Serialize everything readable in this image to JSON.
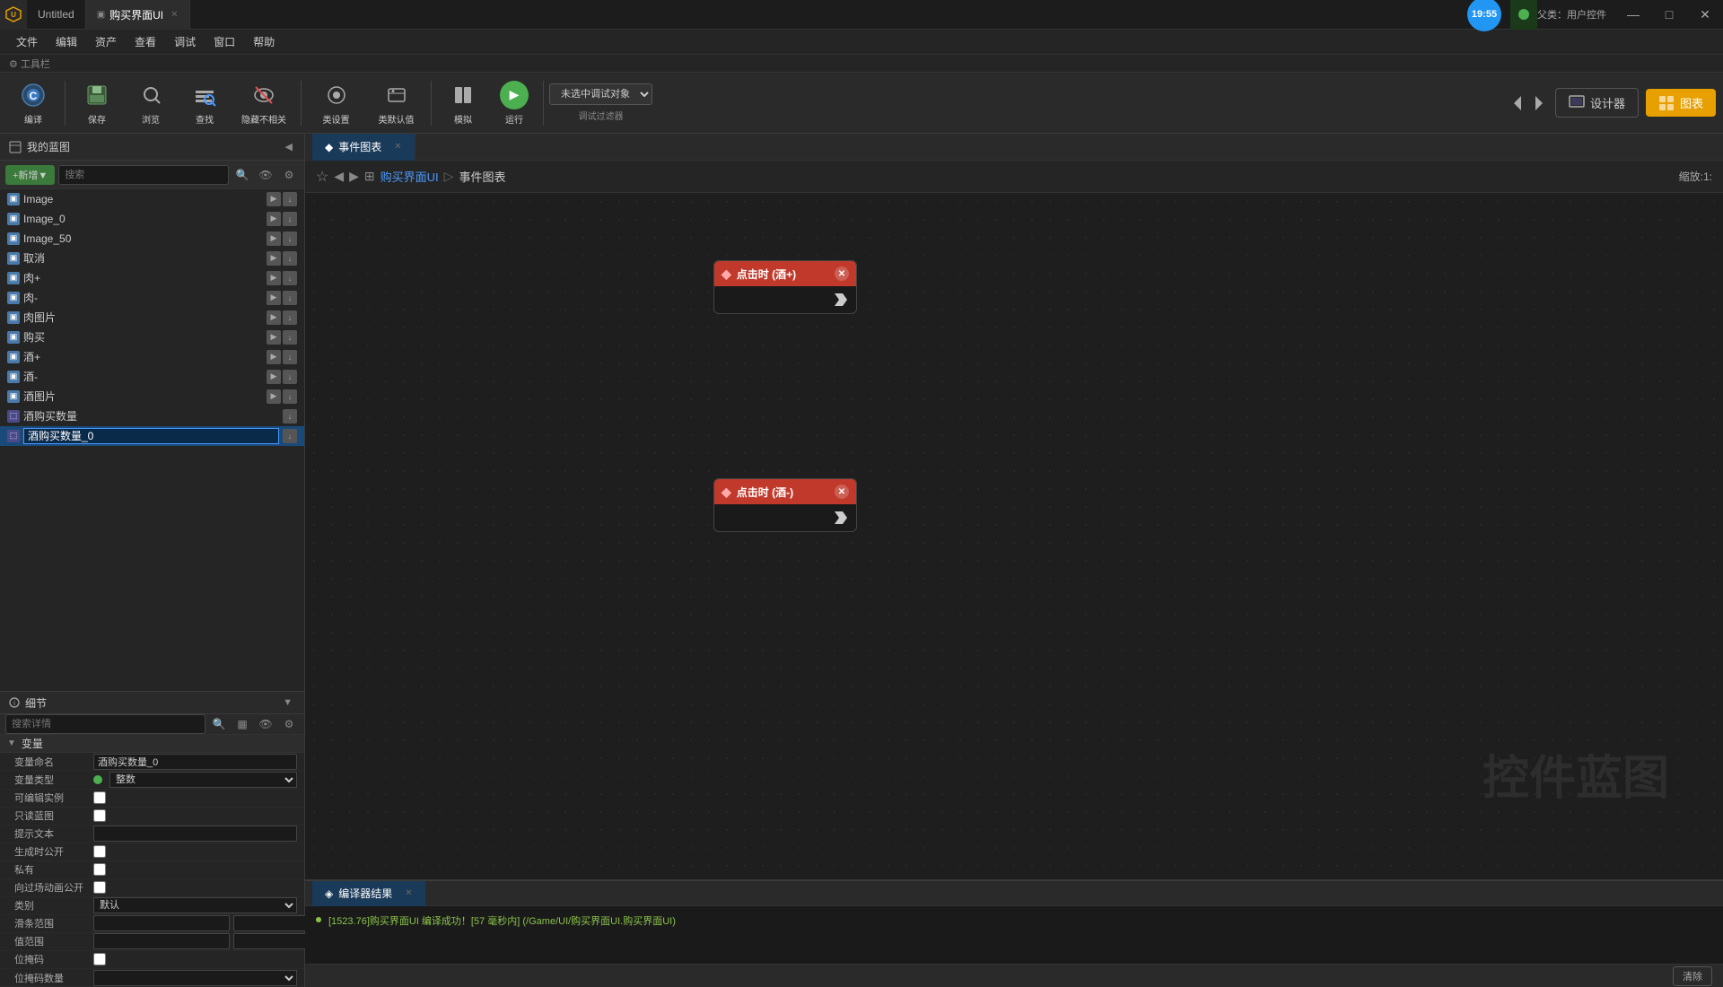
{
  "titlebar": {
    "app_icon": "U",
    "tab1_label": "Untitled",
    "tab2_label": "购买界面UI",
    "tab2_icon": "▣",
    "clock": "19:55",
    "user_label": "父类：用户控件",
    "minimize": "—",
    "restore": "□",
    "close": "✕"
  },
  "menubar": {
    "items": [
      "文件",
      "编辑",
      "资产",
      "查看",
      "调试",
      "窗口",
      "帮助"
    ]
  },
  "toolbar": {
    "section_label": "工具栏",
    "compile": "编译",
    "save": "保存",
    "browse": "浏览",
    "find": "查找",
    "hide_unrelated": "隐藏不相关",
    "class_settings": "类设置",
    "class_defaults": "类默认值",
    "simulate": "模拟",
    "play": "运行",
    "debug_filter": "调试过滤器",
    "debug_select": "未选中调试对象",
    "designer": "设计器",
    "graph": "图表"
  },
  "left_panel": {
    "title": "我的蓝图",
    "collapse_btn": "◀",
    "new_btn": "+新增▼",
    "search_placeholder": "搜索",
    "tree_items": [
      {
        "label": "Image",
        "id": "image"
      },
      {
        "label": "Image_0",
        "id": "image0"
      },
      {
        "label": "Image_50",
        "id": "image50"
      },
      {
        "label": "取消",
        "id": "cancel"
      },
      {
        "label": "肉+",
        "id": "meat_plus"
      },
      {
        "label": "肉-",
        "id": "meat_minus"
      },
      {
        "label": "肉图片",
        "id": "meat_img"
      },
      {
        "label": "购买",
        "id": "buy"
      },
      {
        "label": "酒+",
        "id": "wine_plus"
      },
      {
        "label": "酒-",
        "id": "wine_minus"
      },
      {
        "label": "酒图片",
        "id": "wine_img"
      },
      {
        "label": "酒购买数量",
        "id": "wine_qty"
      },
      {
        "label": "酒购买数量_0",
        "id": "wine_qty_0",
        "editing": true
      }
    ]
  },
  "details_panel": {
    "title": "细节",
    "search_placeholder": "搜索详情",
    "sections": {
      "variables": "变量",
      "var_name_label": "变量命名",
      "var_name_value": "酒购买数量_0",
      "var_type_label": "变量类型",
      "var_type_value": "整数",
      "editable_label": "可编辑实例",
      "readonly_label": "只读蓝图",
      "tooltip_label": "提示文本",
      "gen_public_label": "生成时公开",
      "private_label": "私有",
      "anim_public_label": "向过场动画公开",
      "category_label": "类别",
      "category_value": "默认",
      "slider_range_label": "滑条范围",
      "value_range_label": "值范围",
      "bit_mask_label": "位掩码",
      "bit_mask_count_label": "位掩码数量"
    }
  },
  "bp_tabbar": {
    "tab1_icon": "◆",
    "tab1_label": "事件图表",
    "tab1_close": "✕"
  },
  "breadcrumb": {
    "parent": "购买界面UI",
    "current": "事件图表",
    "scale_label": "缩放:1:",
    "sep1": "▷"
  },
  "canvas": {
    "watermark": "控件蓝图",
    "node1": {
      "title": "点击时 (酒+)",
      "pin_label": ""
    },
    "node2": {
      "title": "点击时 (酒-)",
      "pin_label": ""
    }
  },
  "bottom_panel": {
    "tab_icon": "◈",
    "tab_label": "编译器结果",
    "log_message": "[1523.76]购买界面UI 编译成功！[57 毫秒内] (/Game/UI/购买界面UI.购买界面UI)",
    "clear_label": "清除"
  }
}
